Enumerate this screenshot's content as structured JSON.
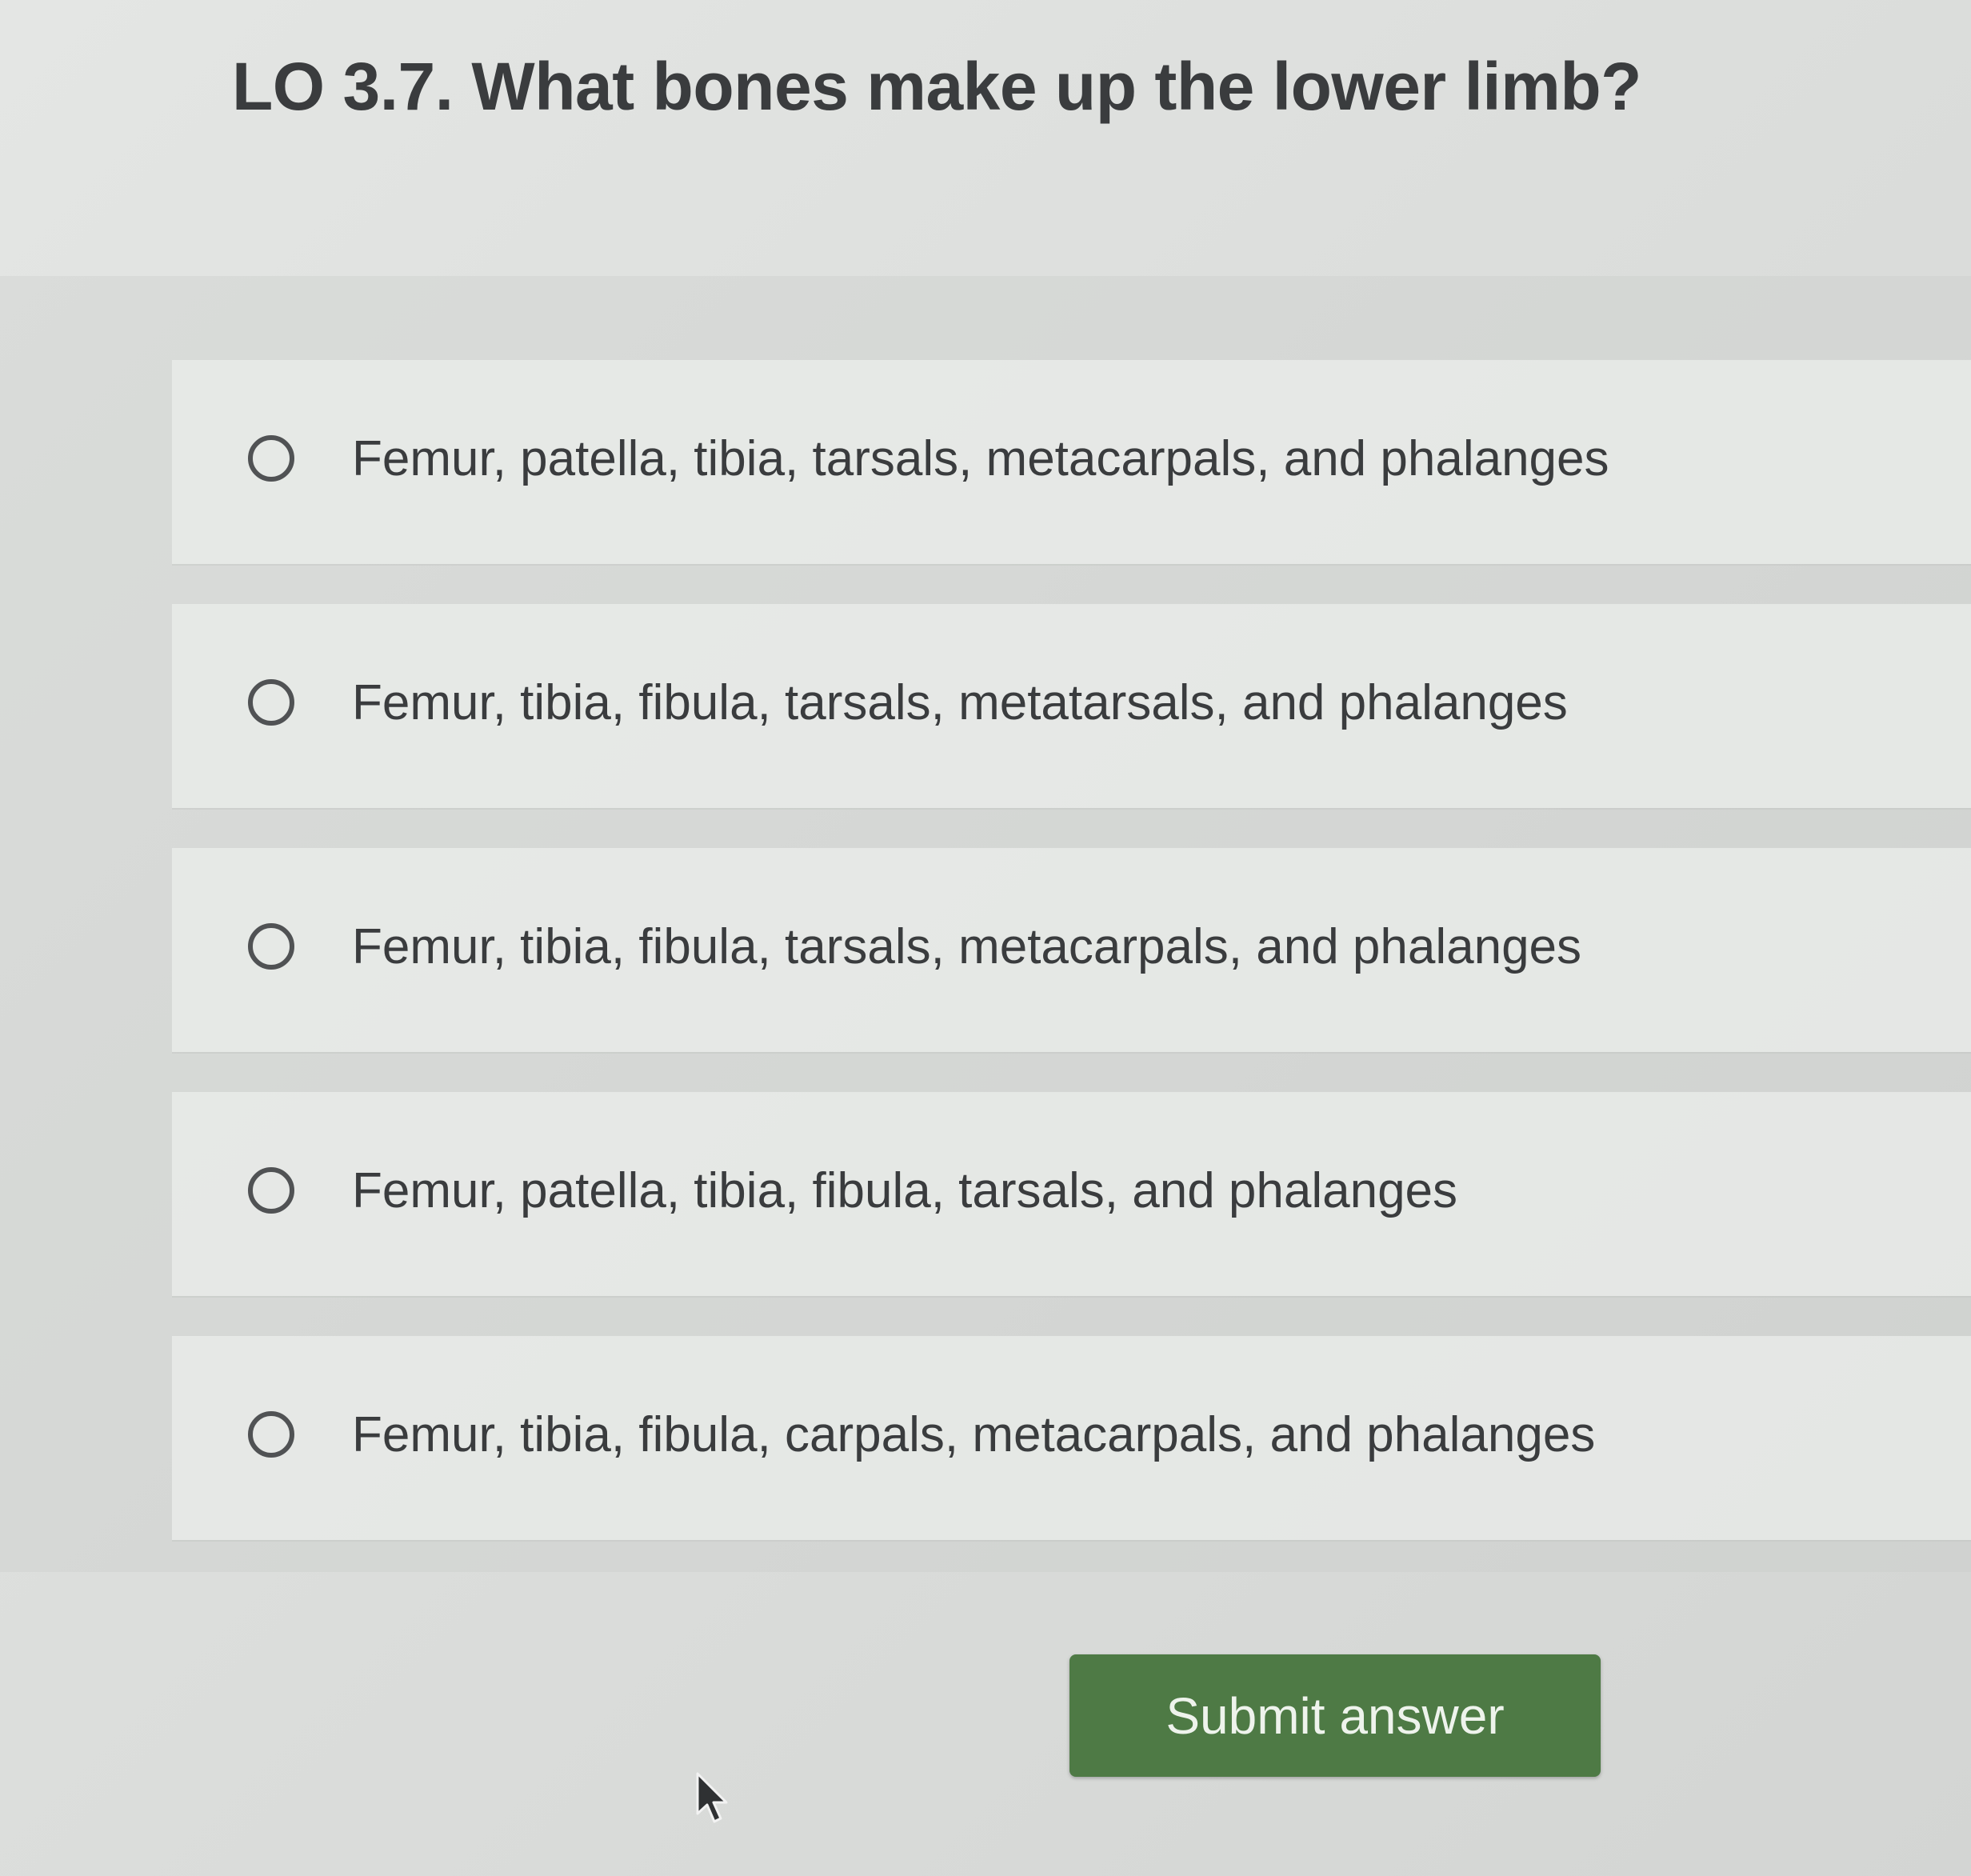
{
  "question": {
    "title": "LO 3.7. What bones make up the lower limb?"
  },
  "options": [
    {
      "label": "Femur, patella, tibia, tarsals, metacarpals, and phalanges"
    },
    {
      "label": "Femur, tibia, fibula, tarsals, metatarsals, and phalanges"
    },
    {
      "label": "Femur, tibia, fibula, tarsals, metacarpals, and phalanges"
    },
    {
      "label": "Femur, patella, tibia, fibula, tarsals, and phalanges"
    },
    {
      "label": "Femur, tibia, fibula, carpals, metacarpals, and phalanges"
    }
  ],
  "submit": {
    "label": "Submit answer",
    "color": "#4e7a45"
  },
  "icons": {
    "radio": "radio-unselected-icon",
    "pointer": "mouse-pointer-icon"
  }
}
